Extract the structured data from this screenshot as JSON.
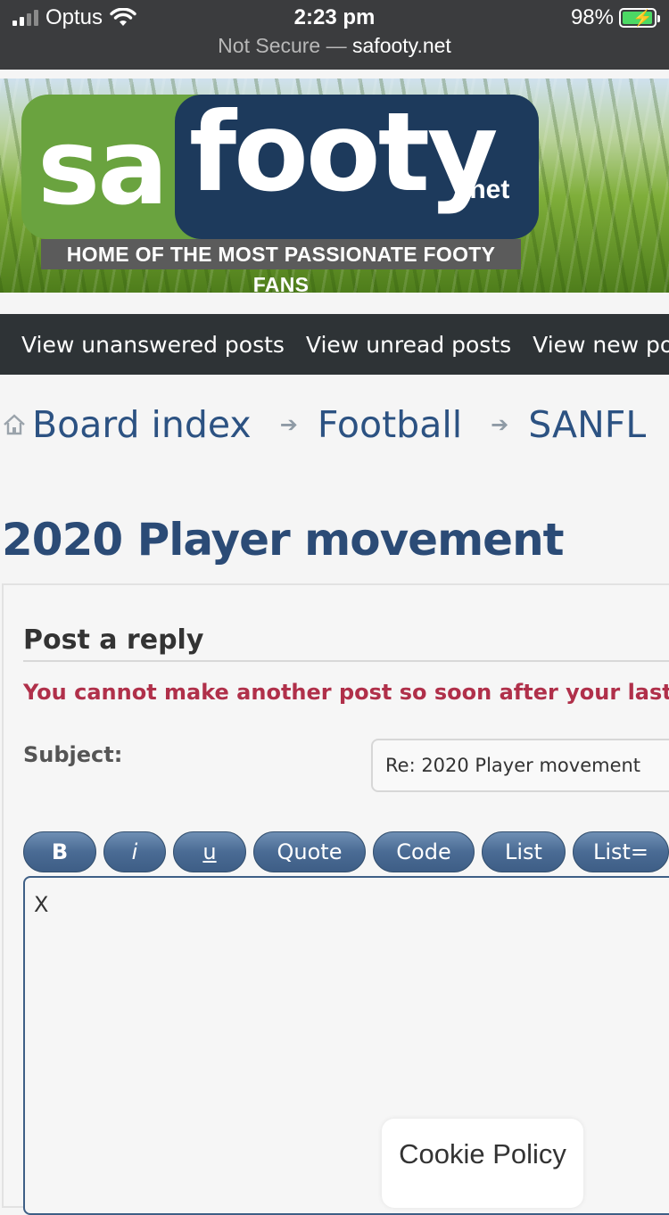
{
  "status_bar": {
    "carrier": "Optus",
    "time": "2:23 pm",
    "battery_percent": "98%",
    "battery_level": 0.98,
    "url_prefix": "Not Secure —",
    "url_host": "safooty.net"
  },
  "banner": {
    "logo_sa": "sa",
    "logo_footy": "footy",
    "logo_tld": ".net",
    "tagline": "HOME OF THE MOST PASSIONATE FOOTY FANS"
  },
  "nav": {
    "items": [
      "View unanswered posts",
      "View unread posts",
      "View new posts"
    ]
  },
  "breadcrumb": {
    "items": [
      "Board index",
      "Football",
      "SANFL"
    ]
  },
  "page": {
    "title": "2020 Player movement"
  },
  "reply_form": {
    "heading": "Post a reply",
    "error": "You cannot make another post so soon after your last.",
    "subject_label": "Subject:",
    "subject_value": "Re: 2020 Player movement",
    "buttons": [
      "B",
      "i",
      "u",
      "Quote",
      "Code",
      "List",
      "List="
    ],
    "message_value": "X"
  },
  "cookie": {
    "label": "Cookie Policy"
  }
}
